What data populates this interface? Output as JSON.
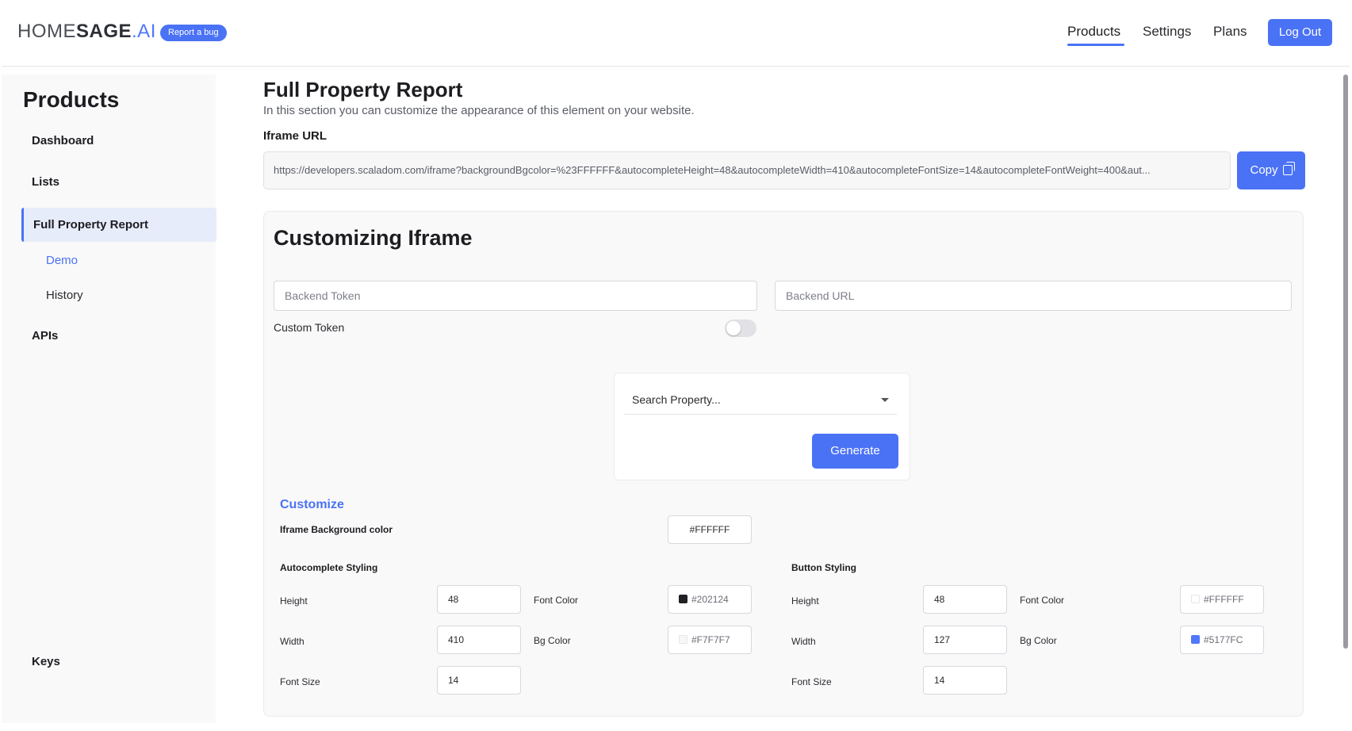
{
  "header": {
    "logo_thin": "HOME",
    "logo_bold": "SAGE",
    "logo_ai": ".AI",
    "bug_badge": "Report a bug",
    "nav": [
      "Products",
      "Settings",
      "Plans"
    ],
    "logout": "Log Out"
  },
  "sidebar": {
    "title": "Products",
    "items": {
      "dashboard": "Dashboard",
      "lists": "Lists",
      "full_report": "Full Property Report",
      "demo": "Demo",
      "history": "History",
      "apis": "APIs",
      "keys": "Keys"
    }
  },
  "main": {
    "title": "Full Property Report",
    "subtitle": "In this section you can customize the appearance of this element on your website.",
    "iframe_label": "Iframe URL",
    "iframe_url": "https://developers.scaladom.com/iframe?backgroundBgcolor=%23FFFFFF&autocompleteHeight=48&autocompleteWidth=410&autocompleteFontSize=14&autocompleteFontWeight=400&aut...",
    "copy_label": "Copy"
  },
  "panel": {
    "title": "Customizing Iframe",
    "backend_token_placeholder": "Backend Token",
    "backend_url_placeholder": "Backend URL",
    "custom_token_label": "Custom Token",
    "search_placeholder": "Search Property...",
    "generate_label": "Generate",
    "customize_title": "Customize",
    "iframe_bg_label": "Iframe Background color",
    "iframe_bg_value": "#FFFFFF",
    "autocomplete": {
      "title": "Autocomplete Styling",
      "height_label": "Height",
      "height": "48",
      "width_label": "Width",
      "width": "410",
      "font_size_label": "Font Size",
      "font_size": "14",
      "font_color_label": "Font Color",
      "font_color": "#202124",
      "bg_color_label": "Bg Color",
      "bg_color": "#F7F7F7"
    },
    "button": {
      "title": "Button Styling",
      "height_label": "Height",
      "height": "48",
      "width_label": "Width",
      "width": "127",
      "font_size_label": "Font Size",
      "font_size": "14",
      "font_color_label": "Font Color",
      "font_color": "#FFFFFF",
      "bg_color_label": "Bg Color",
      "bg_color": "#5177FC"
    }
  },
  "colors": {
    "accent": "#4a72f5",
    "swatch_autocomplete_font": "#202124",
    "swatch_autocomplete_bg": "#F7F7F7",
    "swatch_button_font": "#FFFFFF",
    "swatch_button_bg": "#5177FC"
  }
}
